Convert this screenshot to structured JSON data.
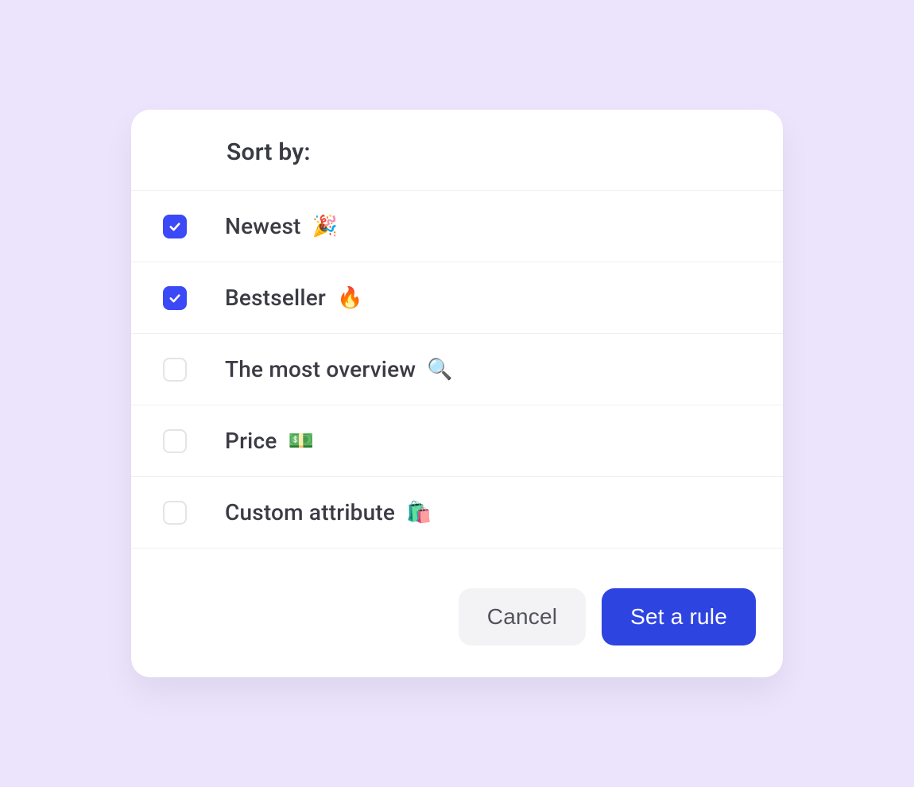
{
  "modal": {
    "title": "Sort by:",
    "options": [
      {
        "label": "Newest",
        "emoji": "🎉",
        "checked": true
      },
      {
        "label": "Bestseller",
        "emoji": "🔥",
        "checked": true
      },
      {
        "label": "The most overview",
        "emoji": "🔍",
        "checked": false
      },
      {
        "label": "Price",
        "emoji": "💵",
        "checked": false
      },
      {
        "label": "Custom attribute",
        "emoji": "🛍️",
        "checked": false
      }
    ],
    "buttons": {
      "cancel": "Cancel",
      "confirm": "Set a rule"
    }
  }
}
